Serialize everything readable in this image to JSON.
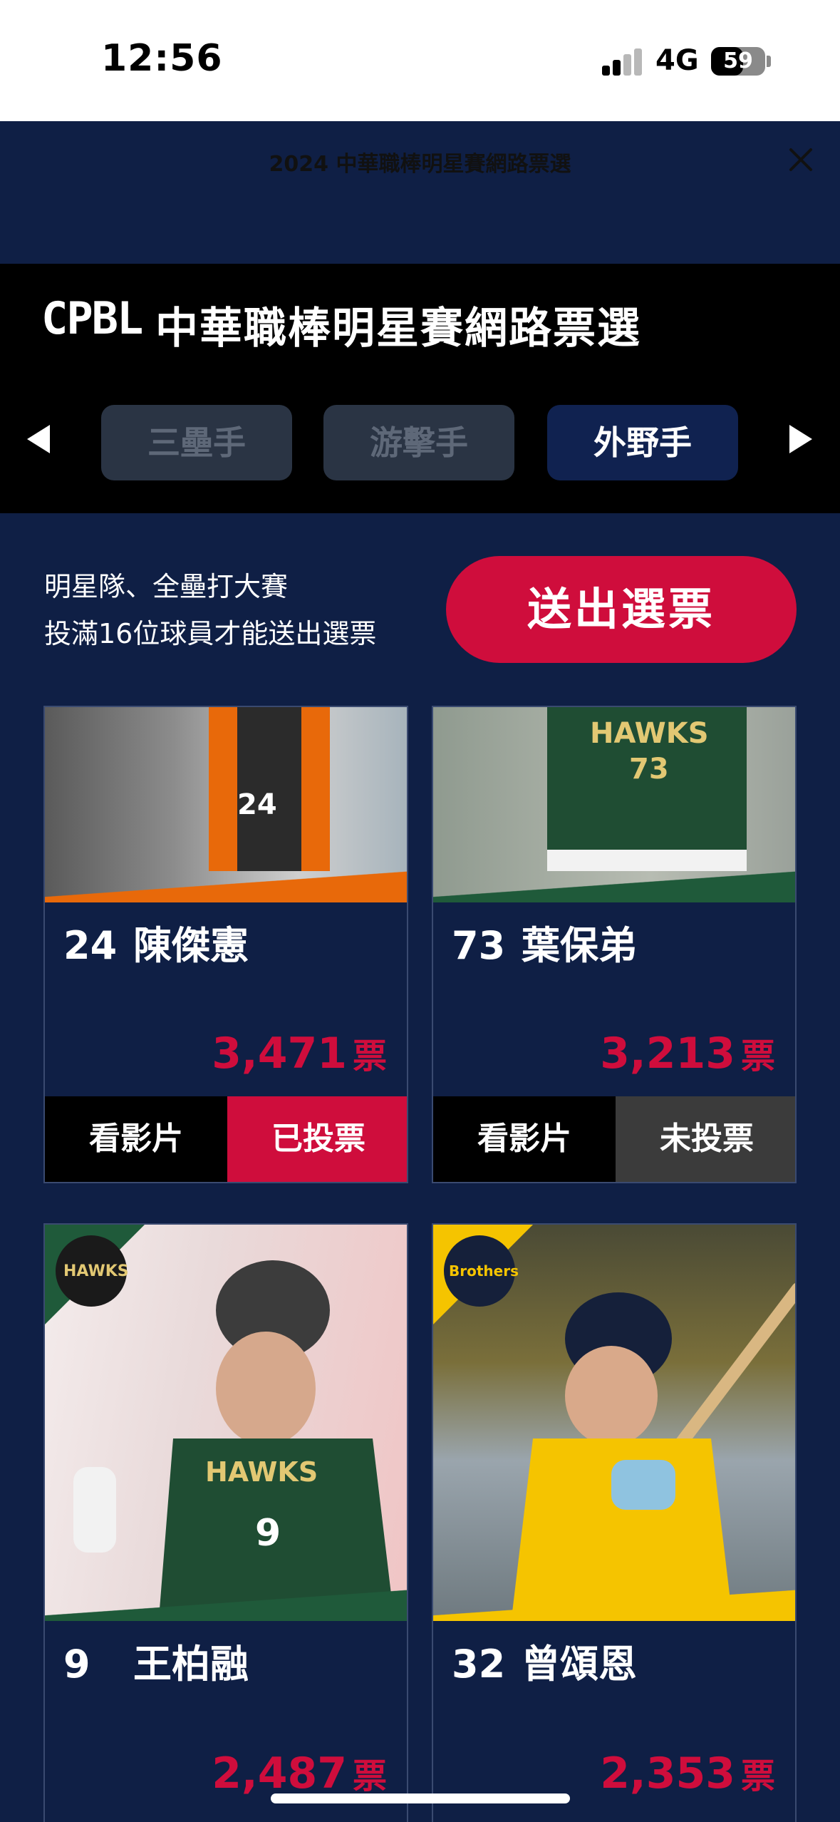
{
  "status_bar": {
    "time": "12:56",
    "network": "4G",
    "battery": "59",
    "battery_level": 0.59
  },
  "webview": {
    "title": "2024 中華職棒明星賽網路票選",
    "close_icon": "close-icon"
  },
  "header": {
    "logo": "CPBL",
    "title": "中華職棒明星賽網路票選"
  },
  "position_tabs": {
    "prev_icon": "triangle-left-icon",
    "next_icon": "triangle-right-icon",
    "items": [
      {
        "label": "三壘手",
        "active": false
      },
      {
        "label": "游擊手",
        "active": false
      },
      {
        "label": "外野手",
        "active": true
      }
    ]
  },
  "info": {
    "line1": "明星隊、全壘打大賽",
    "line2": "投滿16位球員才能送出選票",
    "submit_label": "送出選票"
  },
  "players": [
    {
      "number": "24",
      "name": "陳傑憲",
      "votes": "3,471",
      "unit": "票",
      "video_label": "看影片",
      "vote_status": "已投票",
      "voted": true,
      "team_color": "#e8690a"
    },
    {
      "number": "73",
      "name": "葉保弟",
      "votes": "3,213",
      "unit": "票",
      "video_label": "看影片",
      "vote_status": "未投票",
      "voted": false,
      "team_color": "#1f5a3a"
    },
    {
      "number": "9",
      "name": "王柏融",
      "votes": "2,487",
      "unit": "票",
      "team_logo_text": "TSG HAWKS",
      "team_color": "#1f5a3a"
    },
    {
      "number": "32",
      "name": "曾頌恩",
      "votes": "2,353",
      "unit": "票",
      "team_logo_text": "Brothers",
      "team_color": "#f5c400"
    }
  ]
}
